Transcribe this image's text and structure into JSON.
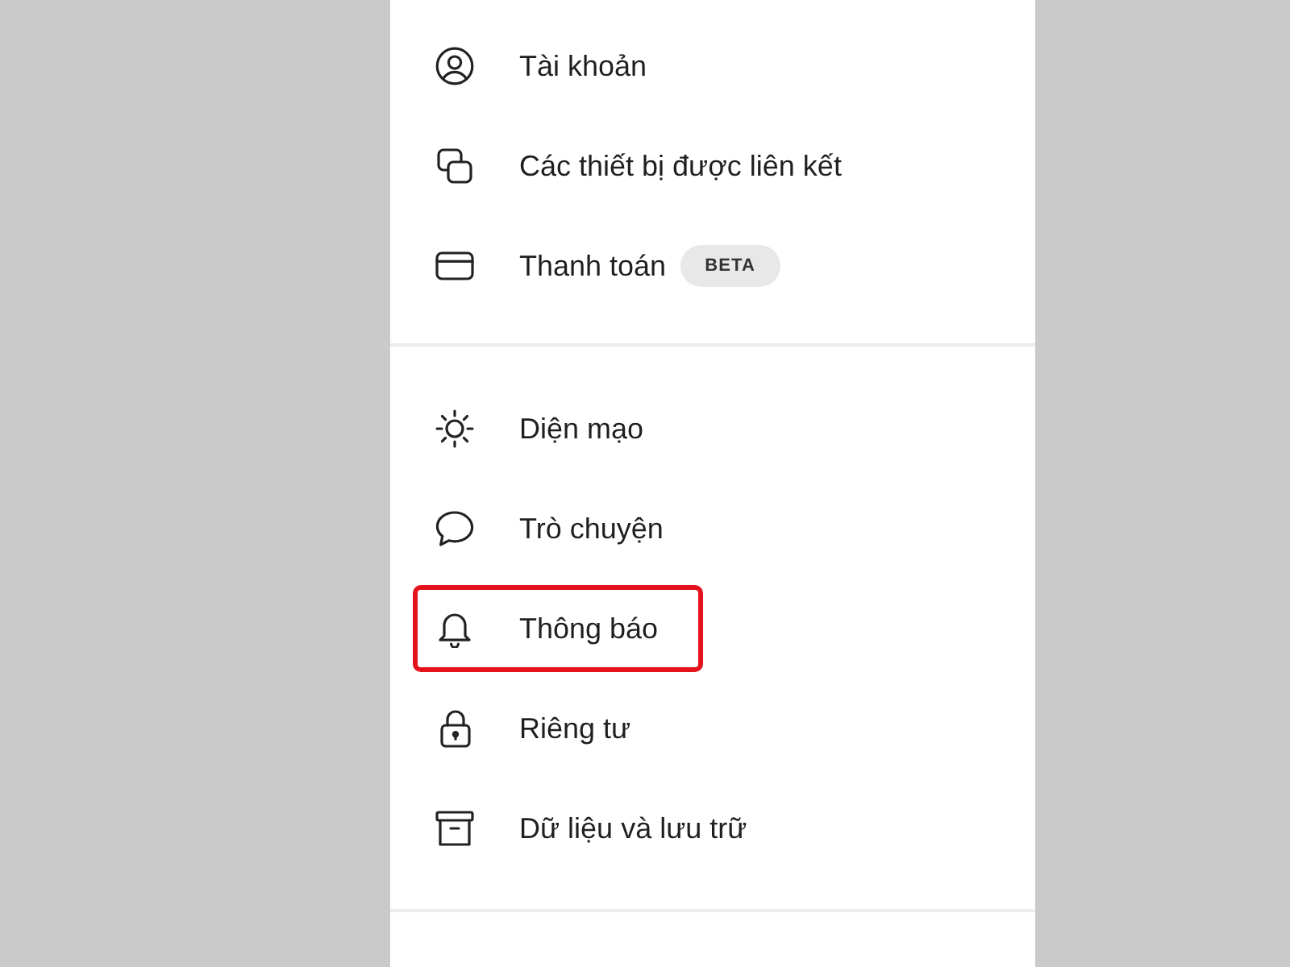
{
  "sections": [
    {
      "items": [
        {
          "label": "Tài khoản",
          "highlighted": false
        },
        {
          "label": "Các thiết bị được liên kết",
          "highlighted": false
        },
        {
          "label": "Thanh toán",
          "badge": "BETA",
          "highlighted": false
        }
      ]
    },
    {
      "items": [
        {
          "label": "Diện mạo",
          "highlighted": false
        },
        {
          "label": "Trò chuyện",
          "highlighted": false
        },
        {
          "label": "Thông báo",
          "highlighted": true
        },
        {
          "label": "Riêng tư",
          "highlighted": false
        },
        {
          "label": "Dữ liệu và lưu trữ",
          "highlighted": false
        }
      ]
    }
  ]
}
